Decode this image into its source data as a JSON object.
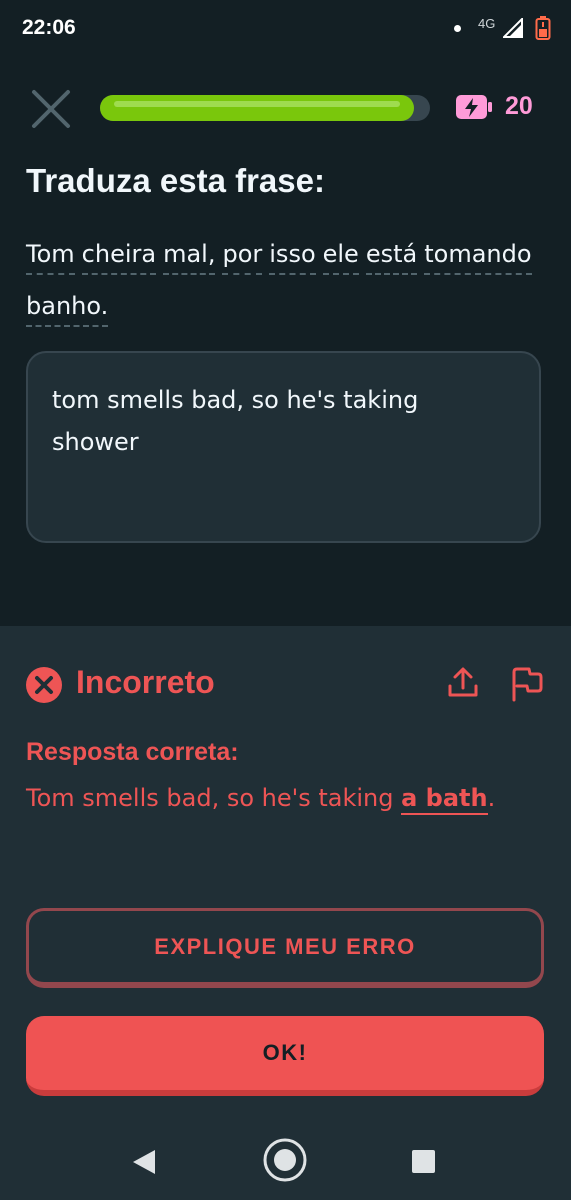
{
  "status_bar": {
    "time": "22:06",
    "network": "4G"
  },
  "lesson": {
    "progress": 0.95,
    "energy_count": "20",
    "accent_progress": "#7ac70c",
    "accent_energy": "#ff9bd8"
  },
  "prompt": {
    "title": "Traduza esta frase:",
    "words": [
      "Tom",
      "cheira",
      "mal,",
      "por",
      "isso",
      "ele",
      "está",
      "tomando",
      "banho."
    ]
  },
  "answer": {
    "text": "tom smells bad, so he's taking\nshower"
  },
  "feedback": {
    "status": "Incorreto",
    "label": "Resposta correta:",
    "correct_prefix": "Tom smells bad, so he's taking ",
    "correct_highlight": "a bath",
    "correct_suffix": ".",
    "color": "#ee5555"
  },
  "buttons": {
    "explain": "EXPLIQUE MEU ERRO",
    "ok": "OK!"
  }
}
